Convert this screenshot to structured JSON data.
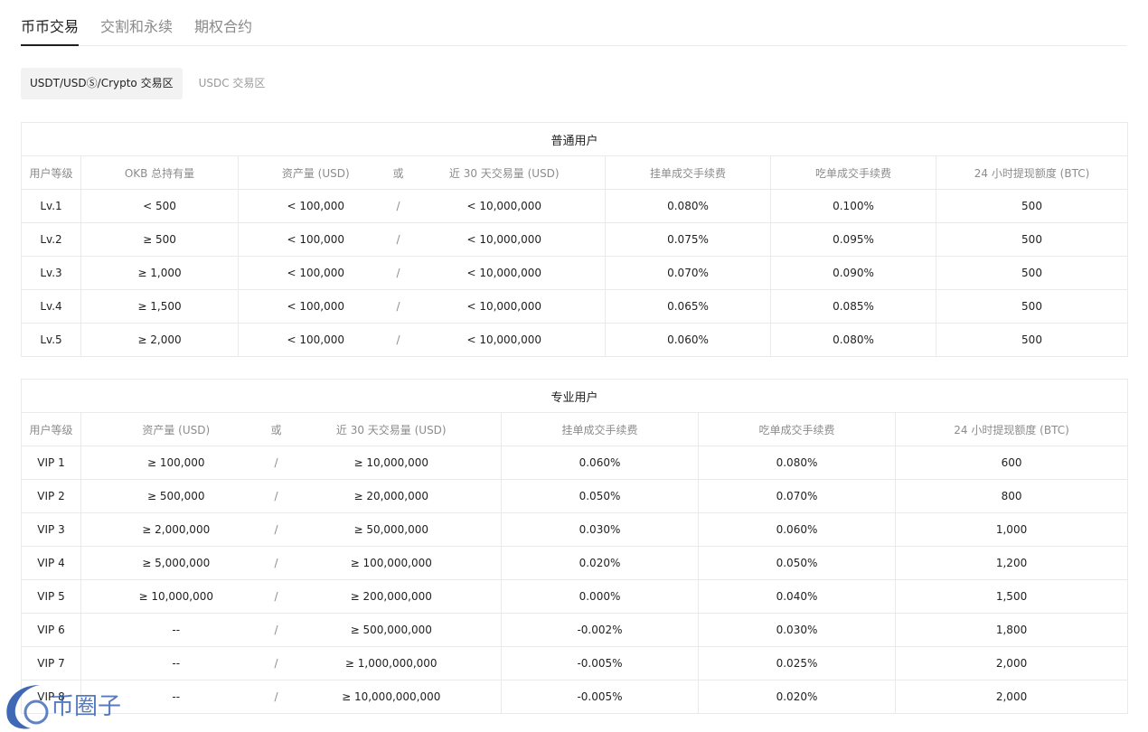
{
  "tabs": [
    {
      "label": "币币交易",
      "active": true
    },
    {
      "label": "交割和永续",
      "active": false
    },
    {
      "label": "期权合约",
      "active": false
    }
  ],
  "subtabs": [
    {
      "label": "USDT/USDⓈ/Crypto 交易区",
      "active": true
    },
    {
      "label": "USDC 交易区",
      "active": false
    }
  ],
  "regular": {
    "title": "普通用户",
    "headers": [
      "用户等级",
      "OKB 总持有量",
      "资产量 (USD)",
      "或",
      "近 30 天交易量 (USD)",
      "挂单成交手续费",
      "吃单成交手续费",
      "24 小时提现额度 (BTC)"
    ],
    "rows": [
      [
        "Lv.1",
        "< 500",
        "< 100,000",
        "/",
        "< 10,000,000",
        "0.080%",
        "0.100%",
        "500"
      ],
      [
        "Lv.2",
        "≥ 500",
        "< 100,000",
        "/",
        "< 10,000,000",
        "0.075%",
        "0.095%",
        "500"
      ],
      [
        "Lv.3",
        "≥ 1,000",
        "< 100,000",
        "/",
        "< 10,000,000",
        "0.070%",
        "0.090%",
        "500"
      ],
      [
        "Lv.4",
        "≥ 1,500",
        "< 100,000",
        "/",
        "< 10,000,000",
        "0.065%",
        "0.085%",
        "500"
      ],
      [
        "Lv.5",
        "≥ 2,000",
        "< 100,000",
        "/",
        "< 10,000,000",
        "0.060%",
        "0.080%",
        "500"
      ]
    ]
  },
  "pro": {
    "title": "专业用户",
    "headers": [
      "用户等级",
      "资产量 (USD)",
      "或",
      "近 30 天交易量 (USD)",
      "挂单成交手续费",
      "吃单成交手续费",
      "24 小时提现额度 (BTC)"
    ],
    "rows": [
      [
        "VIP 1",
        "≥ 100,000",
        "/",
        "≥ 10,000,000",
        "0.060%",
        "0.080%",
        "600"
      ],
      [
        "VIP 2",
        "≥ 500,000",
        "/",
        "≥ 20,000,000",
        "0.050%",
        "0.070%",
        "800"
      ],
      [
        "VIP 3",
        "≥ 2,000,000",
        "/",
        "≥ 50,000,000",
        "0.030%",
        "0.060%",
        "1,000"
      ],
      [
        "VIP 4",
        "≥ 5,000,000",
        "/",
        "≥ 100,000,000",
        "0.020%",
        "0.050%",
        "1,200"
      ],
      [
        "VIP 5",
        "≥ 10,000,000",
        "/",
        "≥ 200,000,000",
        "0.000%",
        "0.040%",
        "1,500"
      ],
      [
        "VIP 6",
        "--",
        "/",
        "≥ 500,000,000",
        "-0.002%",
        "0.030%",
        "1,800"
      ],
      [
        "VIP 7",
        "--",
        "/",
        "≥ 1,000,000,000",
        "-0.005%",
        "0.025%",
        "2,000"
      ],
      [
        "VIP 8",
        "--",
        "/",
        "≥ 10,000,000,000",
        "-0.005%",
        "0.020%",
        "2,000"
      ]
    ]
  },
  "watermark": {
    "text": "币圈子",
    "color": "#1e4fa8"
  }
}
